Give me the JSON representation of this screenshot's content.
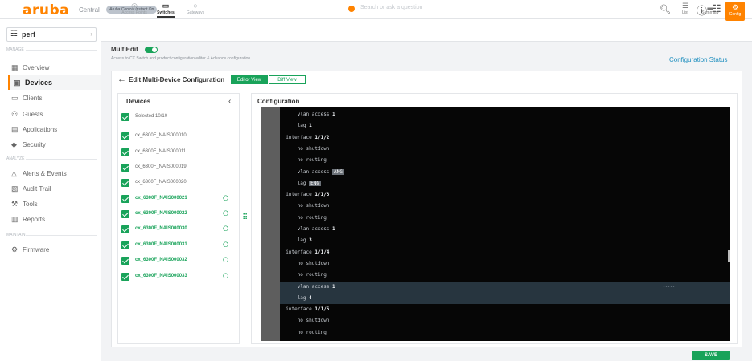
{
  "header": {
    "logo": "aruba",
    "logo_sub": "Central",
    "logo_badge": "Aruba Central Instant On",
    "search_placeholder": "Search or ask a question",
    "icons": [
      "search-icon",
      "help-icon",
      "apps-icon",
      "user-icon"
    ]
  },
  "sidebar": {
    "scope": "perf",
    "sections": {
      "manage": "MANAGE",
      "analyze": "ANALYZE",
      "maintain": "MAINTAIN"
    },
    "items": [
      {
        "label": "Overview",
        "icon": "grid"
      },
      {
        "label": "Devices",
        "icon": "device",
        "active": true
      },
      {
        "label": "Clients",
        "icon": "client"
      },
      {
        "label": "Guests",
        "icon": "guest"
      },
      {
        "label": "Applications",
        "icon": "apps"
      },
      {
        "label": "Security",
        "icon": "shield"
      },
      {
        "label": "Alerts & Events",
        "icon": "bell"
      },
      {
        "label": "Audit Trail",
        "icon": "audit"
      },
      {
        "label": "Tools",
        "icon": "tools"
      },
      {
        "label": "Reports",
        "icon": "report"
      },
      {
        "label": "Firmware",
        "icon": "gear"
      }
    ]
  },
  "device_tabs": [
    {
      "label": "Access Points"
    },
    {
      "label": "Switches",
      "active": true
    },
    {
      "label": "Gateways"
    }
  ],
  "right_tabs": [
    {
      "label": "List"
    },
    {
      "label": "Summary"
    },
    {
      "label": "Config"
    }
  ],
  "multiedit": {
    "label": "MultiEdit",
    "enabled": true,
    "description": "Access to CX Switch and product configuration editor & Advance configuration.",
    "status_link": "Configuration Status"
  },
  "editor_panel": {
    "title": "Edit Multi-Device Configuration",
    "view_editor": "Editor View",
    "view_diff": "Diff View",
    "devices_header": "Devices",
    "config_header": "Configuration",
    "selected": "Selected 10/10",
    "devices": [
      {
        "name": "cx_6300F_NAIS000010",
        "linked": false
      },
      {
        "name": "cx_6300F_NAIS000011",
        "linked": false
      },
      {
        "name": "cx_6300F_NAIS000019",
        "linked": false
      },
      {
        "name": "cx_6300F_NAIS000020",
        "linked": false
      },
      {
        "name": "cx_6300F_NAIS000021",
        "linked": true
      },
      {
        "name": "cx_6300F_NAIS000022",
        "linked": true
      },
      {
        "name": "cx_6300F_NAIS000030",
        "linked": true
      },
      {
        "name": "cx_6300F_NAIS000031",
        "linked": true
      },
      {
        "name": "cx_6300F_NAIS000032",
        "linked": true
      },
      {
        "name": "cx_6300F_NAIS000033",
        "linked": true
      }
    ],
    "code": [
      {
        "indent": "    ",
        "text": "vlan access ",
        "val": "1"
      },
      {
        "indent": "    ",
        "text": "lag ",
        "val": "1"
      },
      {
        "indent": "",
        "text": "interface ",
        "val": "1/1/2"
      },
      {
        "indent": "    ",
        "text": "no shutdown"
      },
      {
        "indent": "    ",
        "text": "no routing"
      },
      {
        "indent": "    ",
        "text": "vlan access ",
        "tag": "ANG"
      },
      {
        "indent": "    ",
        "text": "lag ",
        "tag": "ENG"
      },
      {
        "indent": "",
        "text": "interface ",
        "val": "1/1/3"
      },
      {
        "indent": "    ",
        "text": "no shutdown"
      },
      {
        "indent": "    ",
        "text": "no routing"
      },
      {
        "indent": "    ",
        "text": "vlan access ",
        "val": "1"
      },
      {
        "indent": "    ",
        "text": "lag ",
        "val": "3"
      },
      {
        "indent": "",
        "text": "interface ",
        "val": "1/1/4"
      },
      {
        "indent": "    ",
        "text": "no shutdown"
      },
      {
        "indent": "    ",
        "text": "no routing"
      },
      {
        "indent": "    ",
        "text": "vlan access ",
        "val": "1",
        "highlight": true,
        "mark": "-----"
      },
      {
        "indent": "    ",
        "text": "lag ",
        "val": "4",
        "highlight": true,
        "mark": "-----"
      },
      {
        "indent": "",
        "text": "interface ",
        "val": "1/1/5"
      },
      {
        "indent": "    ",
        "text": "no shutdown"
      },
      {
        "indent": "    ",
        "text": "no routing"
      }
    ],
    "save": "SAVE"
  }
}
